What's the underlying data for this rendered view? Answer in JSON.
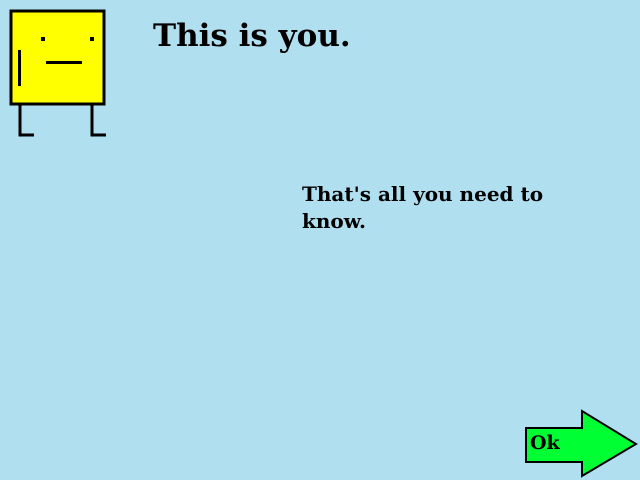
{
  "scene": {
    "background_color": "#b0e0f0",
    "title": "This is you.",
    "message": "That's all you need to know."
  },
  "player": {
    "icon": "yellow-square-character-icon",
    "body_color": "#ffff00",
    "outline_color": "#000000"
  },
  "ok_button": {
    "label": "Ok",
    "icon": "right-arrow-icon",
    "fill_color": "#00ff33"
  }
}
